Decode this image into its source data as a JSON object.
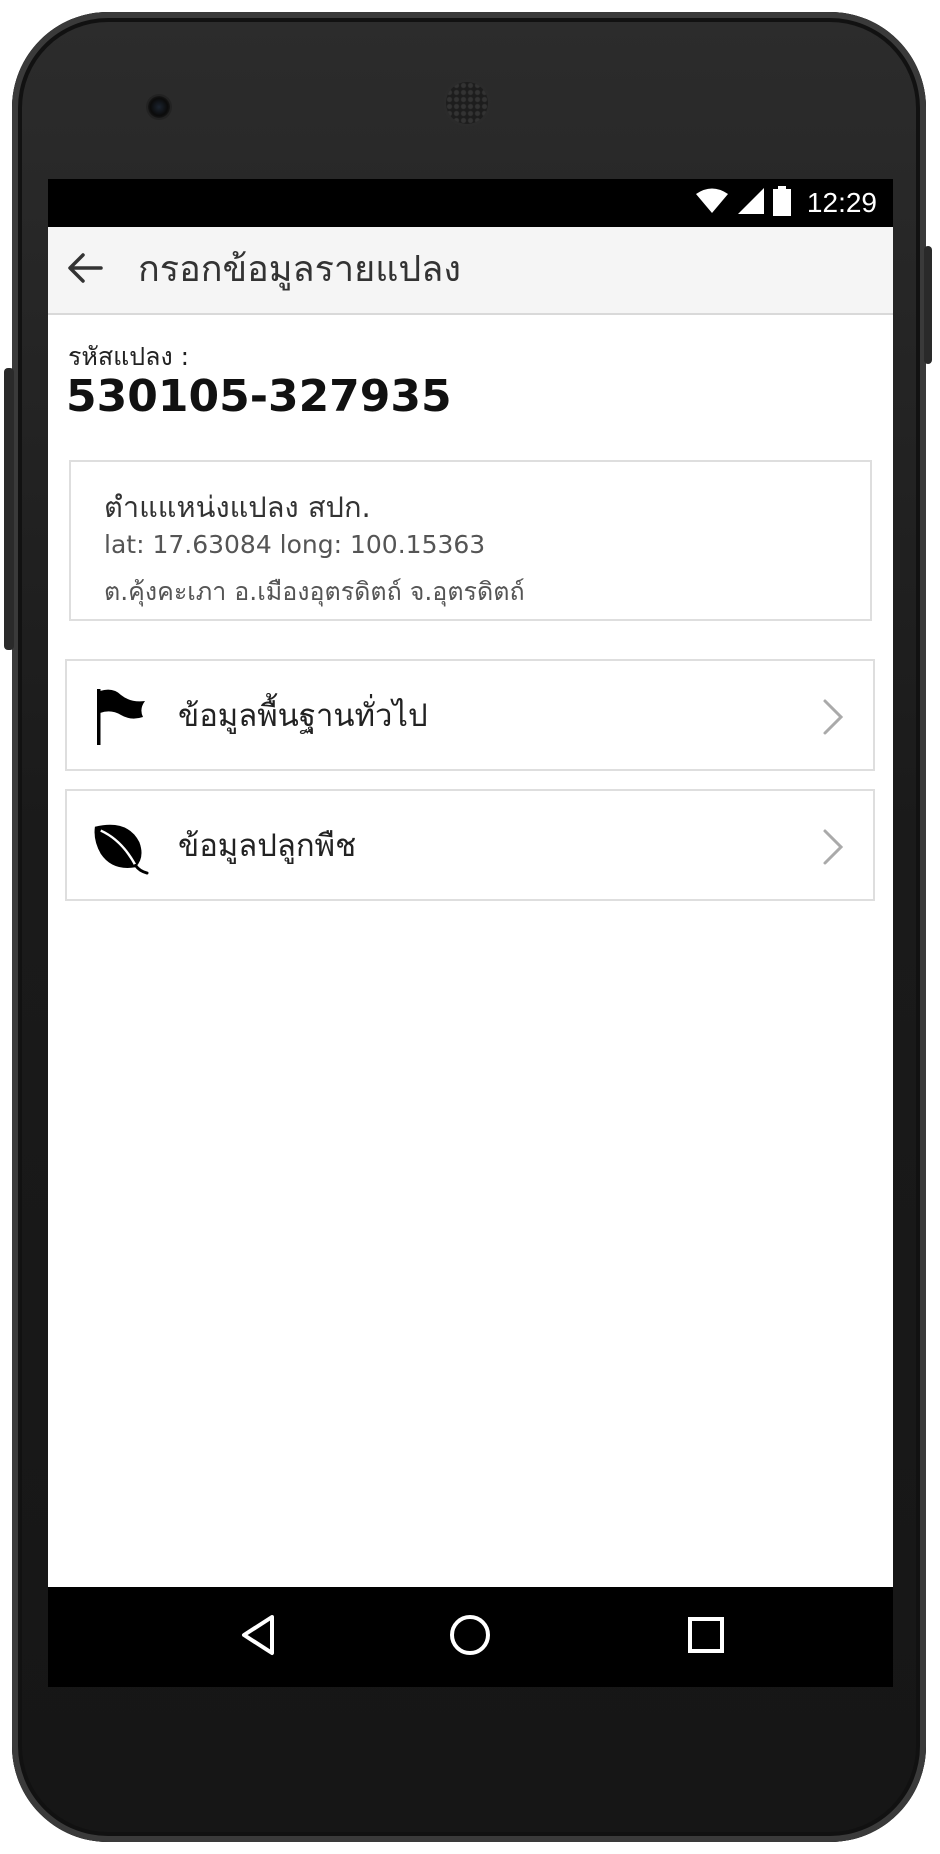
{
  "status_bar": {
    "time": "12:29",
    "icons": [
      "wifi-icon",
      "cell-signal-icon",
      "battery-icon"
    ]
  },
  "app_bar": {
    "back_icon": "arrow-left-icon",
    "title": "กรอกข้อมูลรายแปลง"
  },
  "plot": {
    "label": "รหัสแปลง :",
    "code": "530105-327935"
  },
  "location": {
    "title": "ตำแแหน่งแปลง สปก.",
    "coords": "lat: 17.63084 long: 100.15363",
    "address": "ต.คุ้งคะเภา อ.เมืองอุตรดิตถ์ จ.อุตรดิตถ์"
  },
  "menu": [
    {
      "label": "ข้อมูลพื้นฐานทั่วไป",
      "icon": "flag-icon"
    },
    {
      "label": "ข้อมูลปลูกพืช",
      "icon": "leaf-icon"
    }
  ],
  "nav_bar": {
    "buttons": [
      "nav-back-icon",
      "nav-home-icon",
      "nav-recents-icon"
    ]
  },
  "colors": {
    "app_bar_bg": "#f5f5f5",
    "status_bar_bg": "#000000",
    "card_border": "#dedede",
    "text_primary": "#222222",
    "text_secondary": "#555555"
  }
}
